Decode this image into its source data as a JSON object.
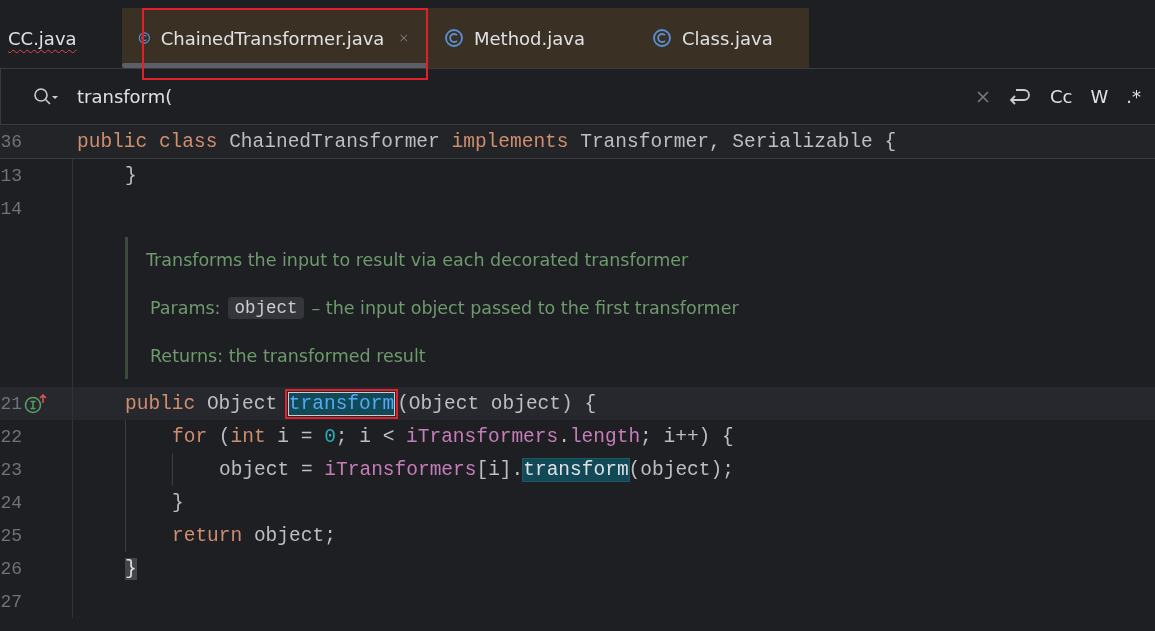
{
  "tabs": [
    {
      "label": "CC.java",
      "selected": false,
      "icon": false,
      "error": true,
      "annotated": false,
      "closable": false
    },
    {
      "label": "ChainedTransformer.java",
      "selected": true,
      "icon": true,
      "error": false,
      "annotated": true,
      "closable": true
    },
    {
      "label": "Method.java",
      "selected": false,
      "icon": true,
      "error": false,
      "annotated": false,
      "closable": false
    },
    {
      "label": "Class.java",
      "selected": false,
      "icon": true,
      "error": false,
      "annotated": false,
      "closable": false
    }
  ],
  "search": {
    "value": "transform(",
    "options": [
      "Cc",
      "W",
      ".*"
    ]
  },
  "sticky_line": {
    "number": "36",
    "tokens": [
      {
        "kind": "keyword",
        "text": "public "
      },
      {
        "kind": "keyword",
        "text": "class "
      },
      {
        "kind": "plain",
        "text": "ChainedTransformer "
      },
      {
        "kind": "keyword",
        "text": "implements "
      },
      {
        "kind": "plain",
        "text": "Transformer, Serializable {"
      }
    ]
  },
  "lines": [
    {
      "kind": "code",
      "number": "13",
      "marker": false,
      "current": false,
      "tokens": [
        {
          "kind": "plain",
          "text": "}"
        }
      ]
    },
    {
      "kind": "code",
      "number": "14",
      "marker": false,
      "current": false
    },
    {
      "kind": "doc",
      "summary": "Transforms the input to result via each decorated transformer",
      "params_label": "Params:",
      "param": "object",
      "param_text": "– the input object passed to the first transformer",
      "returns": "Returns: the transformed result"
    },
    {
      "kind": "code",
      "number": "21",
      "marker": true,
      "current": true,
      "tokens": [
        {
          "kind": "keyword",
          "text": "public "
        },
        {
          "kind": "plain",
          "text": "Object "
        },
        {
          "kind": "match",
          "text": "transform",
          "annotated": true
        },
        {
          "kind": "plain",
          "text": "(Object object) {"
        }
      ],
      "children": [
        {
          "kind": "code",
          "number": "22",
          "marker": false,
          "current": false,
          "tokens": [
            {
              "kind": "keyword",
              "text": "for "
            },
            {
              "kind": "plain",
              "text": "("
            },
            {
              "kind": "keyword",
              "text": "int "
            },
            {
              "kind": "plain",
              "text": "i = "
            },
            {
              "kind": "number",
              "text": "0"
            },
            {
              "kind": "plain",
              "text": "; i < "
            },
            {
              "kind": "field",
              "text": "iTransformers"
            },
            {
              "kind": "plain",
              "text": "."
            },
            {
              "kind": "field",
              "text": "length"
            },
            {
              "kind": "plain",
              "text": "; i++) {"
            }
          ],
          "children": [
            {
              "kind": "code",
              "number": "23",
              "marker": false,
              "current": false,
              "tokens": [
                {
                  "kind": "plain",
                  "text": "object = "
                },
                {
                  "kind": "field",
                  "text": "iTransformers"
                },
                {
                  "kind": "plain",
                  "text": "[i]."
                },
                {
                  "kind": "usage",
                  "text": "transform"
                },
                {
                  "kind": "plain",
                  "text": "(object);"
                }
              ]
            }
          ]
        },
        {
          "kind": "code",
          "number": "24",
          "marker": false,
          "current": false,
          "tokens": [
            {
              "kind": "plain",
              "text": "}"
            }
          ]
        },
        {
          "kind": "code",
          "number": "25",
          "marker": false,
          "current": false,
          "tokens": [
            {
              "kind": "keyword",
              "text": "return "
            },
            {
              "kind": "plain",
              "text": "object;"
            }
          ]
        }
      ]
    },
    {
      "kind": "code",
      "number": "26",
      "marker": false,
      "current": false,
      "tokens": [
        {
          "kind": "brace",
          "text": "}"
        }
      ]
    },
    {
      "kind": "code",
      "number": "27",
      "marker": false,
      "current": false
    }
  ]
}
